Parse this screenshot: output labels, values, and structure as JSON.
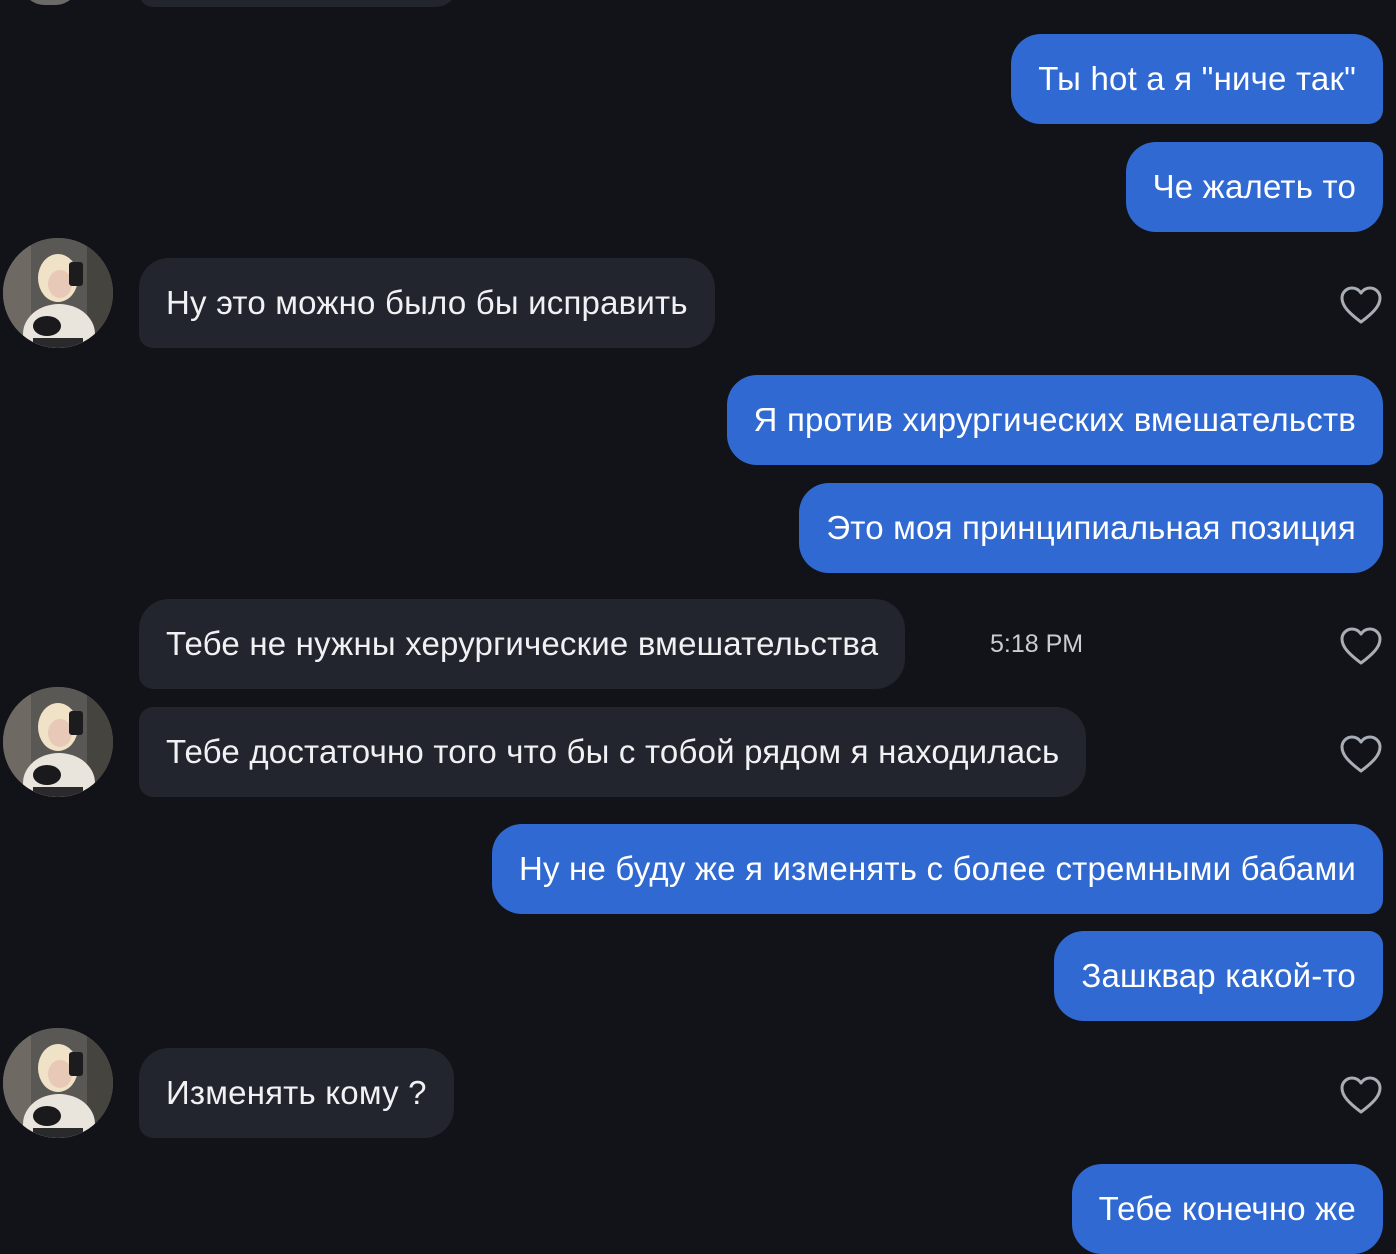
{
  "messages": [
    {
      "id": "m1",
      "side": "out",
      "text": "Ты hot а я \"ниче так\""
    },
    {
      "id": "m2",
      "side": "out",
      "text": "Че жалеть то"
    },
    {
      "id": "m3",
      "side": "in",
      "text": "Ну это можно было бы исправить",
      "avatar": true,
      "liked": true
    },
    {
      "id": "m4",
      "side": "out",
      "text": "Я против хирургических вмешательств"
    },
    {
      "id": "m5",
      "side": "out",
      "text": "Это моя принципиальная позиция"
    },
    {
      "id": "m6",
      "side": "in",
      "text": "Тебе не нужны херургические вмешательства",
      "timestamp": "5:18 PM",
      "liked": true
    },
    {
      "id": "m7",
      "side": "in",
      "text": "Тебе достаточно того что бы с тобой рядом я находилась",
      "avatar": true,
      "liked": true
    },
    {
      "id": "m8",
      "side": "out",
      "text": "Ну не буду же я изменять с более стремными бабами"
    },
    {
      "id": "m9",
      "side": "out",
      "text": "Зашквар какой-то"
    },
    {
      "id": "m10",
      "side": "in",
      "text": "Изменять кому ?",
      "avatar": true,
      "liked": true
    },
    {
      "id": "m11",
      "side": "out",
      "text": "Тебе конечно же"
    }
  ],
  "icons": {
    "like": "heart-outline-icon",
    "avatar": "contact-avatar"
  },
  "colors": {
    "background": "#121318",
    "incoming_bubble": "#22252d",
    "outgoing_bubble": "#3069d1",
    "text": "#f0f1f3",
    "heart": "#a9adb5"
  }
}
